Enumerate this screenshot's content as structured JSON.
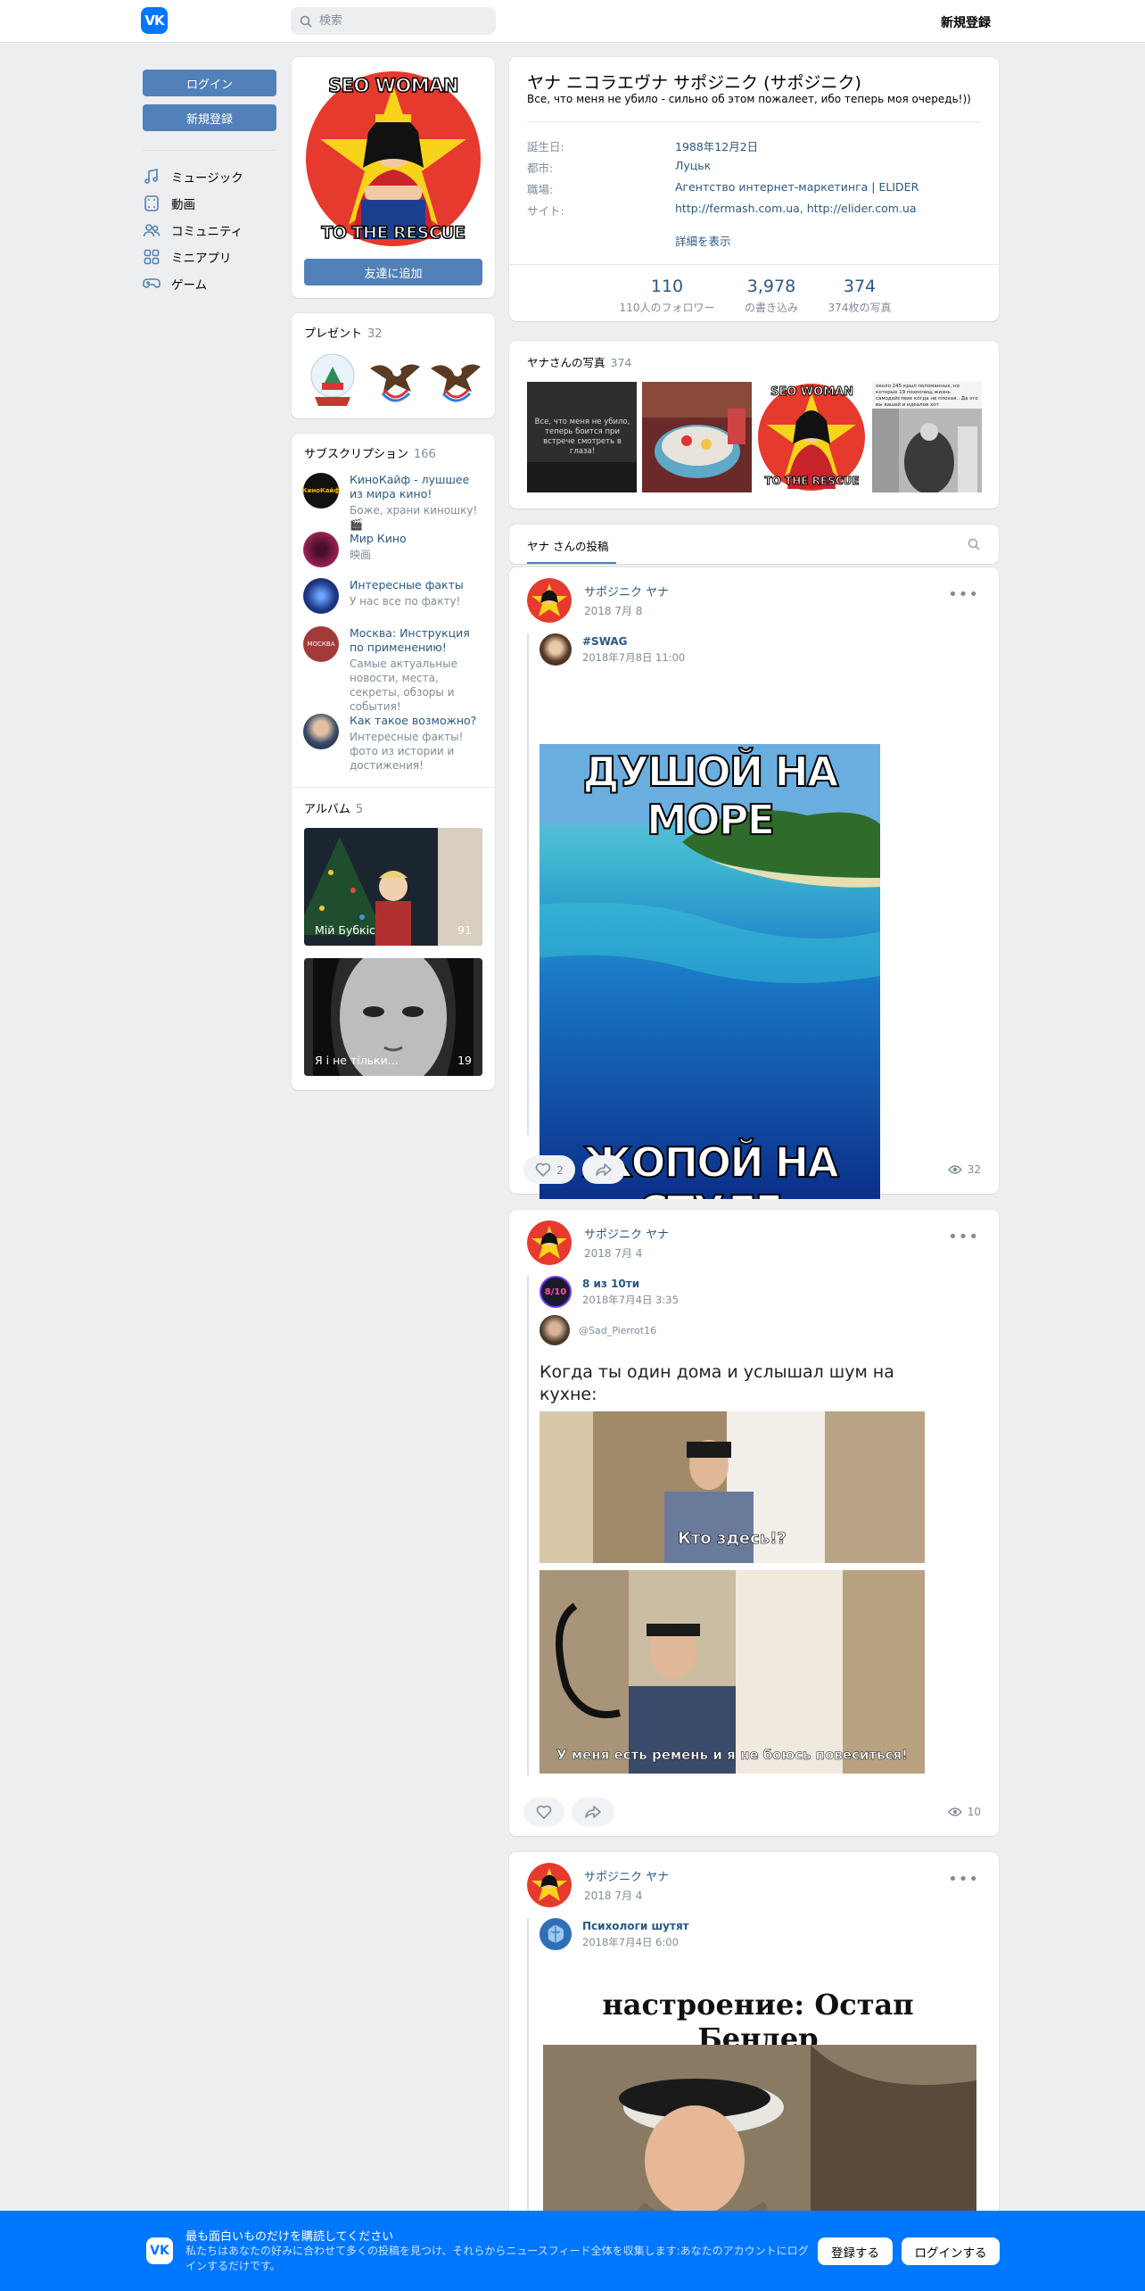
{
  "header": {
    "logo_text": "VK",
    "search_placeholder": "検索",
    "register_label": "新規登録"
  },
  "left_nav": {
    "login_label": "ログイン",
    "register_label": "新規登録",
    "items": [
      {
        "label": "ミュージック",
        "icon": "music-icon"
      },
      {
        "label": "動画",
        "icon": "video-icon"
      },
      {
        "label": "コミュニティ",
        "icon": "community-icon"
      },
      {
        "label": "ミニアプリ",
        "icon": "apps-icon"
      },
      {
        "label": "ゲーム",
        "icon": "gamepad-icon"
      }
    ]
  },
  "profile_photo": {
    "top_text": "SEO WOMAN",
    "bottom_text": "TO THE RESCUE",
    "add_friend_label": "友達に追加"
  },
  "gifts": {
    "title": "プレゼント",
    "count": "32"
  },
  "subscriptions": {
    "title": "サブスクリプション",
    "count": "166",
    "items": [
      {
        "name": "КиноКайф - лушшее из мира кино!",
        "desc": "Боже, храни киношку! 🎬",
        "avatar_text": "КиноКайф",
        "color": "#111111"
      },
      {
        "name": "Мир Кино",
        "desc": "映画",
        "avatar_text": "",
        "color": "#8b1e4a"
      },
      {
        "name": "Интересные факты",
        "desc": "У нас все по факту!",
        "avatar_text": "",
        "color": "#1f3a8a"
      },
      {
        "name": "Москва: Инструкция по применению!",
        "desc": "Самые актуальные новости, места, секреты, обзоры и события!",
        "avatar_text": "МОСКВА",
        "color": "#a33a3a"
      },
      {
        "name": "Как такое возможно?",
        "desc": "Интересные факты! фото из истории и достижения!",
        "avatar_text": "",
        "color": "#3a4a6a"
      }
    ]
  },
  "albums": {
    "title": "アルバム",
    "count": "5",
    "items": [
      {
        "name": "Мій Бубкіс",
        "count": "91"
      },
      {
        "name": "Я і не тільки...",
        "count": "19"
      }
    ]
  },
  "profile": {
    "name": "ヤナ ニコラエヴナ サポジニク (サポジニク)",
    "status": "Все, что меня не убило - сильно об этом пожалеет, ибо теперь моя очередь!))",
    "info": [
      {
        "key": "誕生日:",
        "value": "1988年12月2日"
      },
      {
        "key": "都市:",
        "value": "Луцьк"
      },
      {
        "key": "職場:",
        "value": "Агентство интернет-маркетинга | ELIDER"
      },
      {
        "key": "サイト:",
        "value": "http://fermash.com.ua, http://elider.com.ua"
      }
    ],
    "more_label": "詳細を表示",
    "stats": [
      {
        "number": "110",
        "label": "110人のフォロワー"
      },
      {
        "number": "3,978",
        "label": "の書き込み"
      },
      {
        "number": "374",
        "label": "374枚の写真"
      }
    ]
  },
  "photos": {
    "title": "ヤナさんの写真",
    "count": "374",
    "thumb1_text": "Все, что меня не убило, теперь боится при встрече смотреть в глаза!",
    "thumb3_top": "SEO WOMAN",
    "thumb3_bottom": "TO THE RESCUE",
    "thumb4_text": "около 245 крыл поломанных, но которых 19 похоочищ жизнь самодействие когда не плохая.. Да это вы вашей и идеалов хот"
  },
  "wall": {
    "tab_label": "ヤナ さんの投稿"
  },
  "posts": [
    {
      "author": "サポジニク ヤナ",
      "date": "2018 7月 8",
      "repost_source": "#SWAG",
      "repost_date": "2018年7月8日 11:00",
      "image_top": "ДУШОЙ НА МОРЕ",
      "image_bottom": "ЖОПОЙ НА СТУЛЕ",
      "likes": "2",
      "views": "32"
    },
    {
      "author": "サポジニク ヤナ",
      "date": "2018 7月 4",
      "repost_source": "8 из 10ти",
      "repost_date": "2018年7月4日 3:35",
      "repost_avatar_text": "8/10",
      "inner_user": "@Sad_Pierrot16",
      "text": "Когда ты один дома и услышал шум на кухне:",
      "caption1": "Кто здесь!?",
      "caption2": "У меня есть ремень и я не боюсь повеситься!",
      "views": "10"
    },
    {
      "author": "サポジニク ヤナ",
      "date": "2018 7月 4",
      "repost_source": "Психологи шутят",
      "repost_date": "2018年7月4日 6:00",
      "image_text": "настроение: Остап Бендер"
    }
  ],
  "bottom_banner": {
    "title": "最も面白いものだけを購読してください",
    "desc": "私たちはあなたの好みに合わせて多くの投稿を見つけ、それらからニュースフィード全体を収集します:あなたのアカウントにログインするだけです。",
    "register_label": "登録する",
    "login_label": "ログインする"
  },
  "colors": {
    "accent": "#0077ff",
    "button": "#5181b8",
    "link": "#2a5885",
    "muted": "#818c99",
    "bg": "#edeef0"
  }
}
